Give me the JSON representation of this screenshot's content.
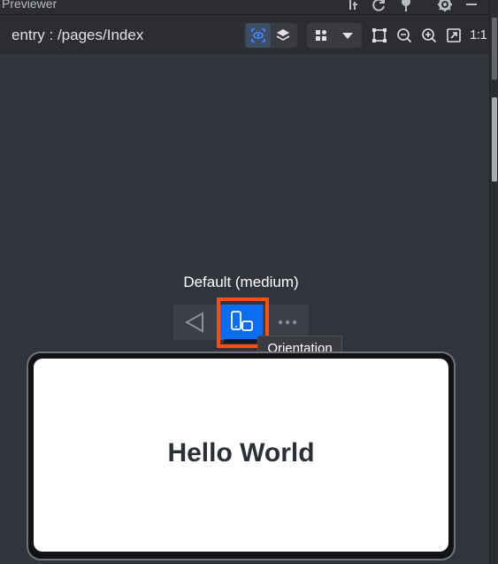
{
  "window": {
    "title": "Previewer",
    "title_icons": [
      "text-cursor-icon",
      "refresh-icon",
      "pin-icon",
      "gear-icon",
      "minimize-icon"
    ]
  },
  "toolbar": {
    "page_path": "entry : /pages/Index",
    "inspector_icon": "inspector-eye-icon",
    "layers_icon": "layers-icon",
    "device_menu_icon": "grid-icon",
    "dropdown_icon": "chevron-down-icon",
    "fit_icon": "fit-frame-icon",
    "zoom_out_icon": "zoom-out-icon",
    "zoom_in_icon": "zoom-in-icon",
    "screenshot_icon": "expand-icon",
    "scale_label": "1:1"
  },
  "preview": {
    "device_label": "Default (medium)",
    "controls": {
      "back_icon": "back-triangle-icon",
      "orientation_icon": "rotate-device-icon",
      "more_icon": "more-dots-icon"
    },
    "tooltip": "Orientation",
    "screen_text": "Hello World"
  },
  "colors": {
    "accent": "#0b6ef2",
    "highlight": "#ff4d12",
    "canvas": "#31343c",
    "panel": "#2b2d30"
  }
}
